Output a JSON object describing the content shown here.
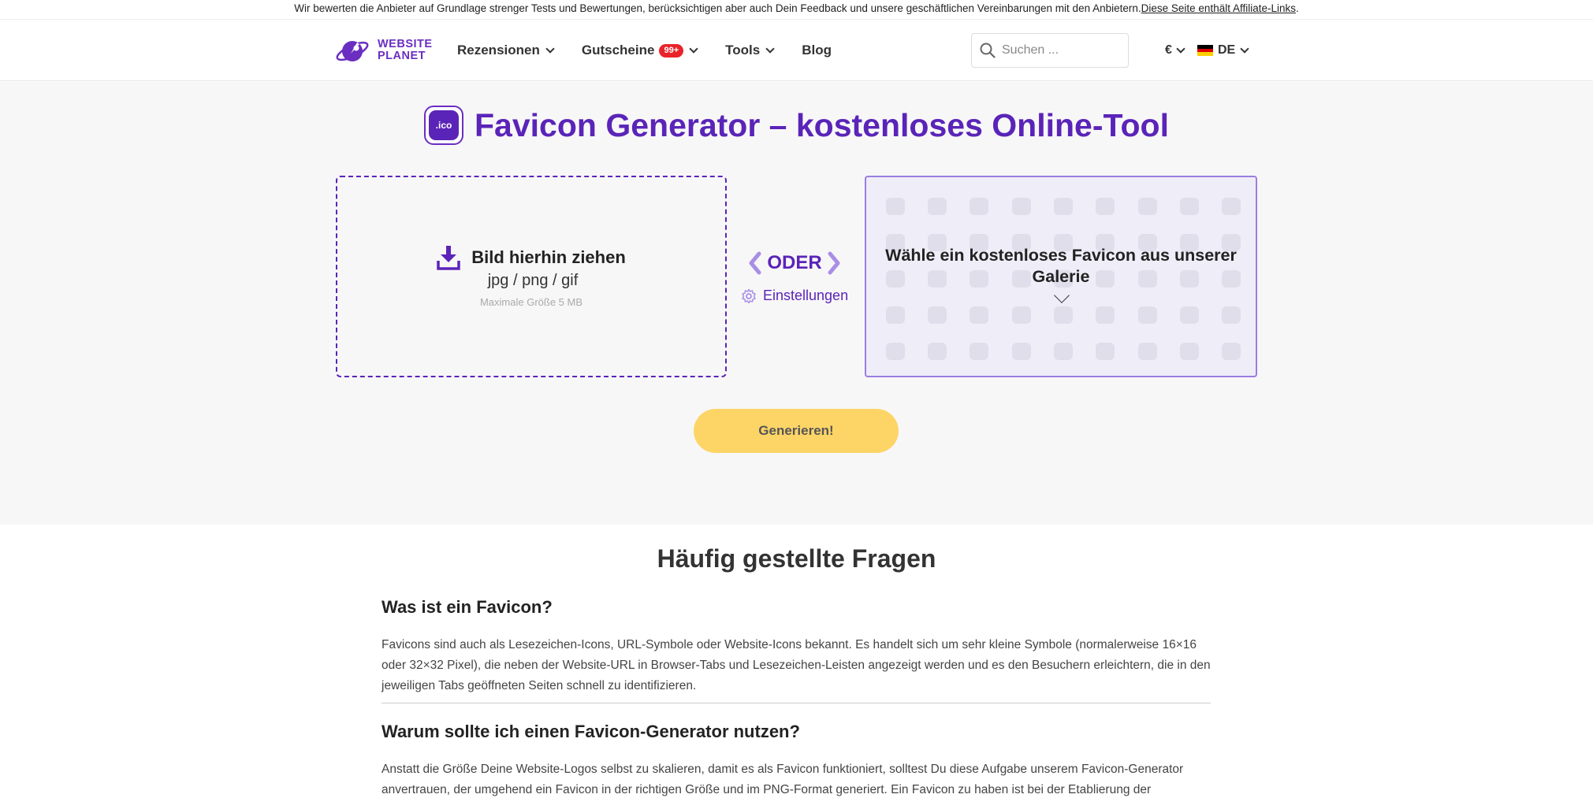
{
  "disclaimer": {
    "text": "Wir bewerten die Anbieter auf Grundlage strenger Tests und Bewertungen, berücksichtigen aber auch Dein Feedback und unsere geschäftlichen Vereinbarungen mit den Anbietern.",
    "link": "Diese Seite enthält Affiliate-Links",
    "period": "."
  },
  "header": {
    "logo_line1": "WEBSITE",
    "logo_line2": "PLANET",
    "nav": {
      "reviews": "Rezensionen",
      "coupons": "Gutscheine",
      "coupons_badge": "99+",
      "tools": "Tools",
      "blog": "Blog"
    },
    "search": {
      "placeholder": "Suchen ..."
    },
    "currency": "€",
    "language": "DE"
  },
  "hero": {
    "icon_label": ".ico",
    "title": "Favicon Generator – kostenloses Online-Tool",
    "dropzone": {
      "title": "Bild hierhin ziehen",
      "formats": "jpg / png / gif",
      "max_size": "Maximale Größe 5 MB"
    },
    "or_label": "ODER",
    "settings_label": "Einstellungen",
    "gallery_text": "Wähle ein kostenloses Favicon aus unserer Galerie",
    "generate_button": "Generieren!"
  },
  "faq": {
    "title": "Häufig gestellte Fragen",
    "items": [
      {
        "question": "Was ist ein Favicon?",
        "answer": "Favicons sind auch als Lesezeichen-Icons, URL-Symbole oder Website-Icons bekannt. Es handelt sich um sehr kleine Symbole (normalerweise 16×16 oder 32×32 Pixel), die neben der Website-URL in Browser-Tabs und Lesezeichen-Leisten angezeigt werden und es den Besuchern erleichtern, die in den jeweiligen Tabs geöffneten Seiten schnell zu identifizieren."
      },
      {
        "question": "Warum sollte ich einen Favicon-Generator nutzen?",
        "answer": "Anstatt die Größe Deine Website-Logos selbst zu skalieren, damit es als Favicon funktioniert, solltest Du diese Aufgabe unserem Favicon-Generator anvertrauen, der umgehend ein Favicon in der richtigen Größe und im PNG-Format generiert. Ein Favicon zu haben ist bei der Etablierung der"
      }
    ]
  },
  "colors": {
    "brand_purple": "#5a24b8",
    "generate_yellow": "#fdd567",
    "badge_red": "#e8242a"
  }
}
